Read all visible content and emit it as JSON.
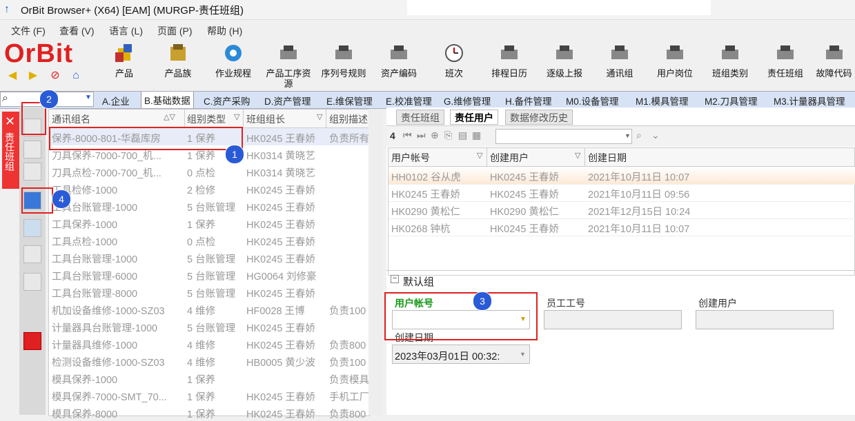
{
  "window": {
    "title": "OrBit Browser+ (X64) [EAM] (MURGP-责任班组)"
  },
  "menu": [
    "文件 (F)",
    "查看 (V)",
    "语言 (L)",
    "页面 (P)",
    "帮助 (H)"
  ],
  "logo": "OrBit",
  "toolbar": [
    "产品",
    "产品族",
    "作业规程",
    "产品工序资源",
    "序列号规则",
    "资产编码",
    "班次",
    "排程日历",
    "逐级上报",
    "通讯组",
    "用户岗位",
    "班组类别",
    "责任班组",
    "故障代码"
  ],
  "module_tabs": [
    "A.企业",
    "B.基础数据",
    "C.资产采购",
    "D.资产管理",
    "E.维保管理",
    "E.校准管理",
    "G.维修管理",
    "H.备件管理",
    "M0.设备管理",
    "M1.模具管理",
    "M2.刀具管理",
    "M3.计量器具管理"
  ],
  "sidebar": {
    "vertical_tab": "责任班组"
  },
  "left_grid": {
    "headers": [
      "通讯组名",
      "组别类型",
      "班组组长",
      "组别描述"
    ],
    "rows": [
      [
        "保养-8000-801-华磊库房",
        "1 保养",
        "HK0245 王春娇",
        "负责所有"
      ],
      [
        "刀具保养-7000-700_机...",
        "1 保养",
        "HK0314 黄晓艺",
        ""
      ],
      [
        "刀具点检-7000-700_机...",
        "0 点检",
        "HK0314 黄晓艺",
        ""
      ],
      [
        "工具检修-1000",
        "2 检修",
        "HK0245 王春娇",
        ""
      ],
      [
        "工具台账管理-1000",
        "5 台账管理",
        "HK0245 王春娇",
        ""
      ],
      [
        "工具保养-1000",
        "1 保养",
        "HK0245 王春娇",
        ""
      ],
      [
        "工具点检-1000",
        "0 点检",
        "HK0245 王春娇",
        ""
      ],
      [
        "工具台账管理-1000",
        "5 台账管理",
        "HK0245 王春娇",
        ""
      ],
      [
        "工具台账管理-6000",
        "5 台账管理",
        "HG0064 刘修豪",
        ""
      ],
      [
        "工具台账管理-8000",
        "5 台账管理",
        "HK0245 王春娇",
        ""
      ],
      [
        "机加设备维修-1000-SZ03",
        "4 维修",
        "HF0028 王博",
        "负责100"
      ],
      [
        "计量器具台账管理-1000",
        "5 台账管理",
        "HK0245 王春娇",
        ""
      ],
      [
        "计量器具维修-1000",
        "4 维修",
        "HK0245 王春娇",
        "负责800"
      ],
      [
        "检测设备维修-1000-SZ03",
        "4 维修",
        "HB0005 黄少波",
        "负责100"
      ],
      [
        "模具保养-1000",
        "1 保养",
        "",
        "负责模具"
      ],
      [
        "模具保养-7000-SMT_70...",
        "1 保养",
        "HK0245 王春娇",
        "手机工厂"
      ],
      [
        "模具保养-8000",
        "1 保养",
        "HK0245 王春娇",
        "负责800"
      ]
    ]
  },
  "right_tabs": [
    "责任班组",
    "责任用户",
    "数据修改历史"
  ],
  "right_toolbar": {
    "count": "4"
  },
  "right_grid": {
    "headers": [
      "用户帐号",
      "创建用户",
      "创建日期"
    ],
    "rows": [
      [
        "HH0102 谷从虎",
        "HK0245 王春娇",
        "2021年10月11日 10:07"
      ],
      [
        "HK0245 王春娇",
        "HK0245 王春娇",
        "2021年10月11日 09:56"
      ],
      [
        "HK0290 黄松仁",
        "HK0290 黄松仁",
        "2021年12月15日 10:24"
      ],
      [
        "HK0268 钟杭",
        "HK0245 王春娇",
        "2021年10月11日 10:07"
      ]
    ]
  },
  "form": {
    "group_title": "默认组",
    "user_account_label": "用户帐号",
    "employee_no_label": "员工工号",
    "created_by_label": "创建用户",
    "created_date_label": "创建日期",
    "created_date_value": "2023年03月01日 00:32:"
  },
  "badges": [
    "1",
    "2",
    "3",
    "4"
  ],
  "colors": {
    "accent_red": "#e02020",
    "badge_blue": "#2a5bd7",
    "tab_blue": "#d7e3f5",
    "label_green": "#1a9a1a"
  }
}
